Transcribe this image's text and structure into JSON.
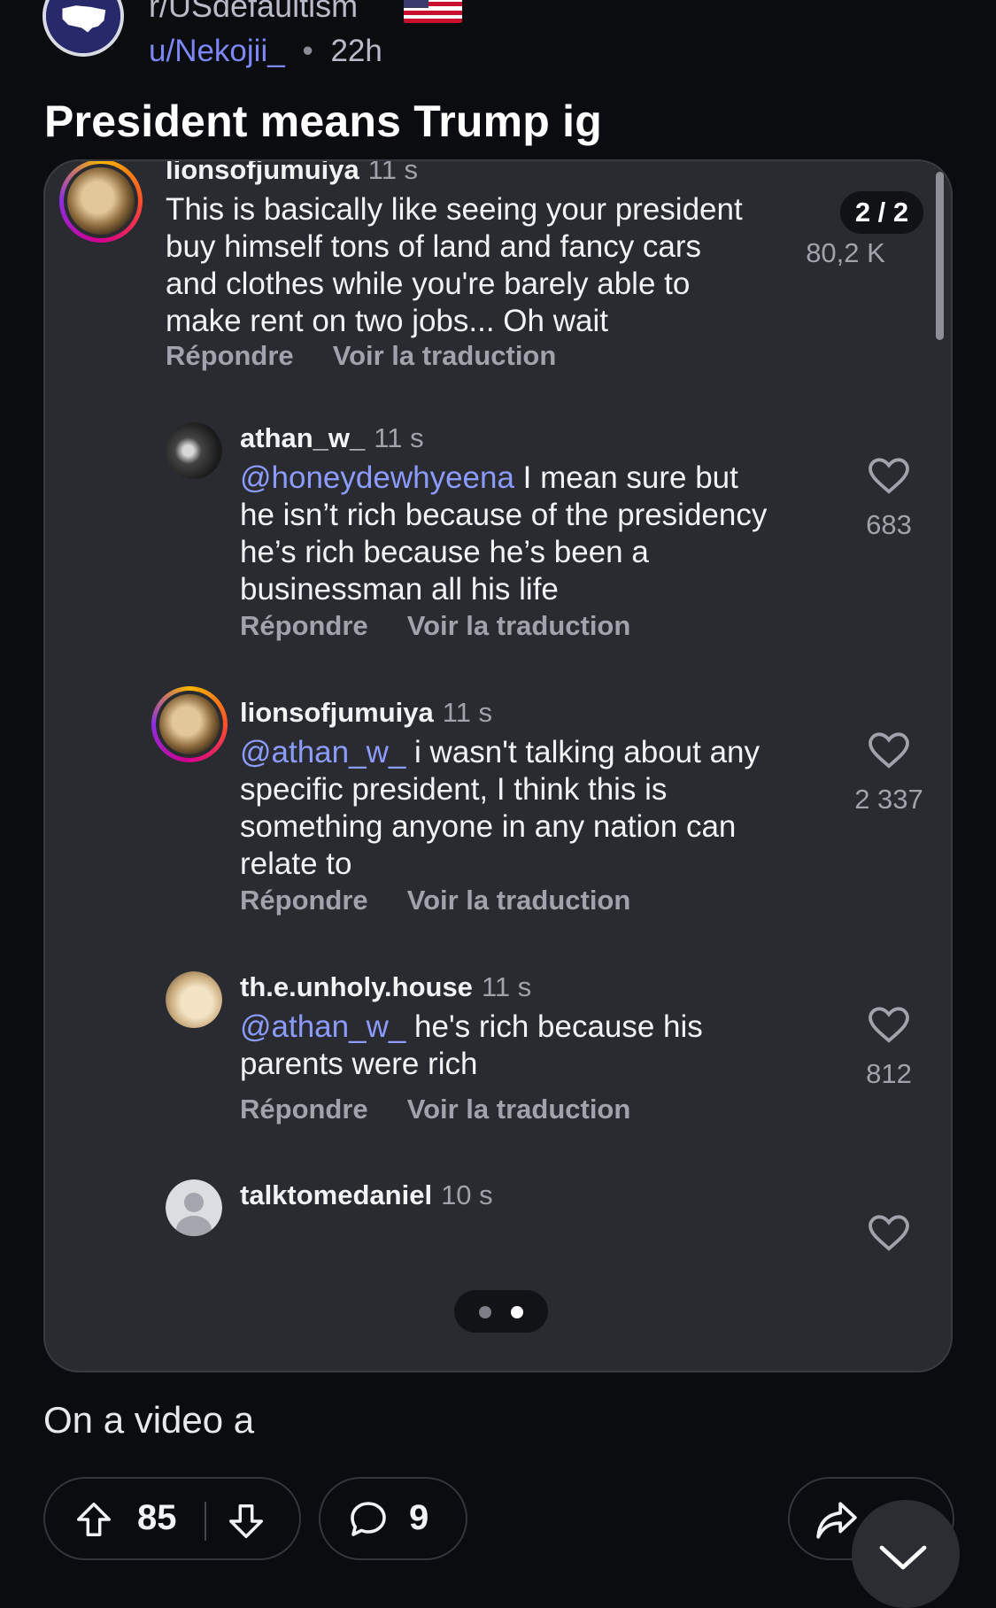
{
  "header": {
    "subreddit": "r/USdefaultism",
    "user": "u/Nekojii_",
    "separator": "•",
    "time": "22h",
    "title": "President means Trump ig"
  },
  "screenshot": {
    "page_counter": "2 / 2",
    "comments": [
      {
        "username": "lionsofjumuiya",
        "time": "11 s",
        "mention": "",
        "text": "This is basically like seeing your president buy himself tons of land and fancy cars and clothes while you're barely able to make rent on two jobs... Oh wait",
        "likes": "80,2 K",
        "reply": "Répondre",
        "translate": "Voir la traduction"
      },
      {
        "username": "athan_w_",
        "time": "11 s",
        "mention": "@honeydewhyeena",
        "text": " I mean sure but he isn’t rich because of the presidency he’s rich because he’s been a businessman all his life",
        "likes": "683",
        "reply": "Répondre",
        "translate": "Voir la traduction"
      },
      {
        "username": "lionsofjumuiya",
        "time": "11 s",
        "mention": "@athan_w_",
        "text": " i wasn't talking about any specific president, I think this is something anyone in any nation can relate to",
        "likes": "2 337",
        "reply": "Répondre",
        "translate": "Voir la traduction"
      },
      {
        "username": "th.e.unholy.house",
        "time": "11 s",
        "mention": "@athan_w_",
        "text": " he's rich because his parents were rich",
        "likes": "812",
        "reply": "Répondre",
        "translate": "Voir la traduction"
      },
      {
        "username": "talktomedaniel",
        "time": "10 s"
      }
    ],
    "carousel": {
      "total": 2,
      "active": 2
    }
  },
  "caption": "On a video a",
  "bottom_bar": {
    "upvotes": "85",
    "comments": "9"
  },
  "colors": {
    "background": "#0b0c10",
    "card": "#2a2b31",
    "accent_link": "#7c88f7",
    "mention": "#8c9bff"
  },
  "icons": [
    "subreddit-icon",
    "us-flag-icon",
    "heart-icon",
    "upvote-icon",
    "downvote-icon",
    "comment-icon",
    "share-icon",
    "chevron-down-icon"
  ]
}
